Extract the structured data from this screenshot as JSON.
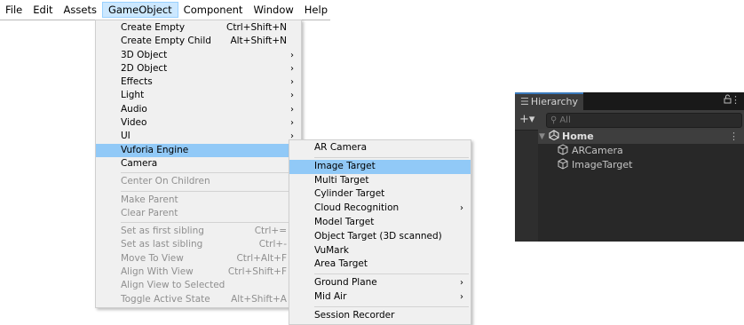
{
  "menubar": {
    "items": [
      "File",
      "Edit",
      "Assets",
      "GameObject",
      "Component",
      "Window",
      "Help"
    ]
  },
  "gameobject_menu": {
    "items": [
      {
        "label": "Create Empty",
        "shortcut": "Ctrl+Shift+N"
      },
      {
        "label": "Create Empty Child",
        "shortcut": "Alt+Shift+N"
      },
      {
        "label": "3D Object",
        "submenu": true
      },
      {
        "label": "2D Object",
        "submenu": true
      },
      {
        "label": "Effects",
        "submenu": true
      },
      {
        "label": "Light",
        "submenu": true
      },
      {
        "label": "Audio",
        "submenu": true
      },
      {
        "label": "Video",
        "submenu": true
      },
      {
        "label": "UI",
        "submenu": true
      },
      {
        "label": "Vuforia Engine",
        "submenu": true,
        "highlighted": true
      },
      {
        "label": "Camera"
      },
      {
        "label": "Center On Children",
        "disabled": true
      },
      {
        "label": "Make Parent",
        "disabled": true
      },
      {
        "label": "Clear Parent",
        "disabled": true
      },
      {
        "label": "Set as first sibling",
        "shortcut": "Ctrl+=",
        "disabled": true
      },
      {
        "label": "Set as last sibling",
        "shortcut": "Ctrl+-",
        "disabled": true
      },
      {
        "label": "Move To View",
        "shortcut": "Ctrl+Alt+F",
        "disabled": true
      },
      {
        "label": "Align With View",
        "shortcut": "Ctrl+Shift+F",
        "disabled": true
      },
      {
        "label": "Align View to Selected",
        "disabled": true
      },
      {
        "label": "Toggle Active State",
        "shortcut": "Alt+Shift+A",
        "disabled": true
      }
    ],
    "submenu_arrow": "›"
  },
  "vuforia_menu": {
    "items": [
      {
        "label": "AR Camera"
      },
      {
        "label": "Image Target",
        "highlighted": true
      },
      {
        "label": "Multi Target"
      },
      {
        "label": "Cylinder Target"
      },
      {
        "label": "Cloud Recognition",
        "submenu": true
      },
      {
        "label": "Model Target"
      },
      {
        "label": "Object Target (3D scanned)"
      },
      {
        "label": "VuMark"
      },
      {
        "label": "Area Target"
      },
      {
        "label": "Ground Plane",
        "submenu": true
      },
      {
        "label": "Mid Air",
        "submenu": true
      },
      {
        "label": "Session Recorder"
      }
    ]
  },
  "hierarchy": {
    "tab_label": "Hierarchy",
    "search_placeholder": "All",
    "scene_name": "Home",
    "objects": [
      "ARCamera",
      "ImageTarget"
    ],
    "icons": {
      "tab": "list-icon",
      "lock": "lock-icon",
      "menu": "kebab-icon",
      "add": "plus-icon",
      "search": "search-icon",
      "scene": "unity-icon",
      "object": "cube-icon"
    }
  },
  "colors": {
    "menu_highlight": "#91c9f7",
    "menubar_active": "#cce8ff",
    "panel_bg": "#282828"
  }
}
